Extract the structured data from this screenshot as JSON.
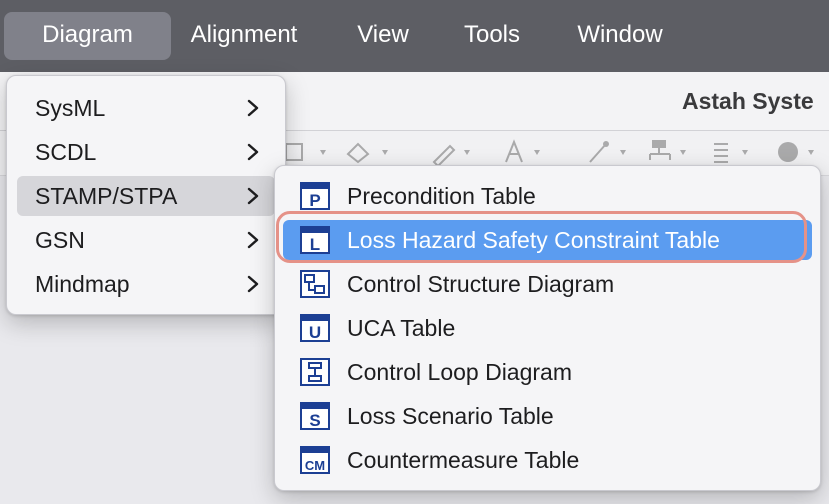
{
  "menubar": {
    "items": [
      "Diagram",
      "Alignment",
      "View",
      "Tools",
      "Window"
    ]
  },
  "window": {
    "title": "Astah Syste"
  },
  "diagram_menu": {
    "items": [
      {
        "label": "SysML",
        "icon": "chevron-right-icon"
      },
      {
        "label": "SCDL",
        "icon": "chevron-right-icon"
      },
      {
        "label": "STAMP/STPA",
        "icon": "chevron-right-icon"
      },
      {
        "label": "GSN",
        "icon": "chevron-right-icon"
      },
      {
        "label": "Mindmap",
        "icon": "chevron-right-icon"
      }
    ],
    "hovered": "STAMP/STPA"
  },
  "stamp_menu": {
    "items": [
      {
        "label": "Precondition Table",
        "icon": "precondition-table-icon",
        "glyph": "P"
      },
      {
        "label": "Loss Hazard Safety Constraint Table",
        "icon": "loss-hazard-table-icon",
        "glyph": "L"
      },
      {
        "label": "Control Structure Diagram",
        "icon": "control-structure-diagram-icon",
        "glyph": ""
      },
      {
        "label": "UCA Table",
        "icon": "uca-table-icon",
        "glyph": "U"
      },
      {
        "label": "Control Loop Diagram",
        "icon": "control-loop-diagram-icon",
        "glyph": ""
      },
      {
        "label": "Loss Scenario Table",
        "icon": "loss-scenario-table-icon",
        "glyph": "S"
      },
      {
        "label": "Countermeasure Table",
        "icon": "countermeasure-table-icon",
        "glyph": "CM"
      }
    ],
    "selected": "Loss Hazard Safety Constraint Table"
  },
  "colors": {
    "menubar": "#5d5e64",
    "selection": "#5b9cf0",
    "highlight_ring": "#e59288",
    "icon_blue": "#1c3f94"
  }
}
